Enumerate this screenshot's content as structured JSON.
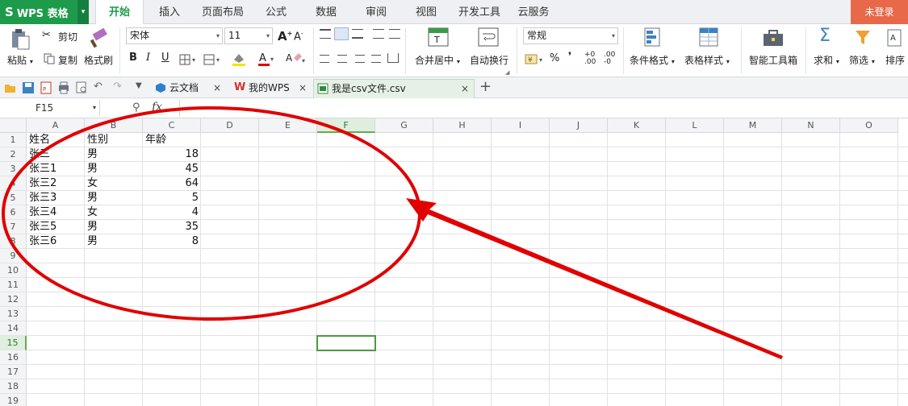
{
  "app": {
    "logo": "WPS 表格",
    "login": "未登录"
  },
  "menu": [
    "开始",
    "插入",
    "页面布局",
    "公式",
    "数据",
    "审阅",
    "视图",
    "开发工具",
    "云服务"
  ],
  "ribbon": {
    "paste": "粘贴",
    "cut": "剪切",
    "copy": "复制",
    "format_painter": "格式刷",
    "font_name": "宋体",
    "font_size": "11",
    "merge_center": "合并居中",
    "wrap_text": "自动换行",
    "number_format": "常规",
    "percent": "%",
    "comma": "❜",
    "conditional_format": "条件格式",
    "table_style": "表格样式",
    "smart_tools": "智能工具箱",
    "sum": "求和",
    "filter": "筛选",
    "sort": "排序"
  },
  "tabs": [
    {
      "label": "云文档",
      "active": false
    },
    {
      "label": "我的WPS",
      "active": false
    },
    {
      "label": "我是csv文件.csv",
      "active": true
    }
  ],
  "formula_bar": {
    "cell_ref": "F15",
    "fx": "fx"
  },
  "sheet": {
    "columns": [
      "A",
      "B",
      "C",
      "D",
      "E",
      "F",
      "G",
      "H",
      "I",
      "J",
      "K",
      "L",
      "M",
      "N",
      "O"
    ],
    "selected_column": "F",
    "selected_row": 15,
    "rows": [
      [
        "姓名",
        "性别",
        "年龄"
      ],
      [
        "张三",
        "男",
        "18"
      ],
      [
        "张三1",
        "男",
        "45"
      ],
      [
        "张三2",
        "女",
        "64"
      ],
      [
        "张三3",
        "男",
        "5"
      ],
      [
        "张三4",
        "女",
        "4"
      ],
      [
        "张三5",
        "男",
        "35"
      ],
      [
        "张三6",
        "男",
        "8"
      ]
    ],
    "row_count": 19
  },
  "annotation_color": "#e00000"
}
